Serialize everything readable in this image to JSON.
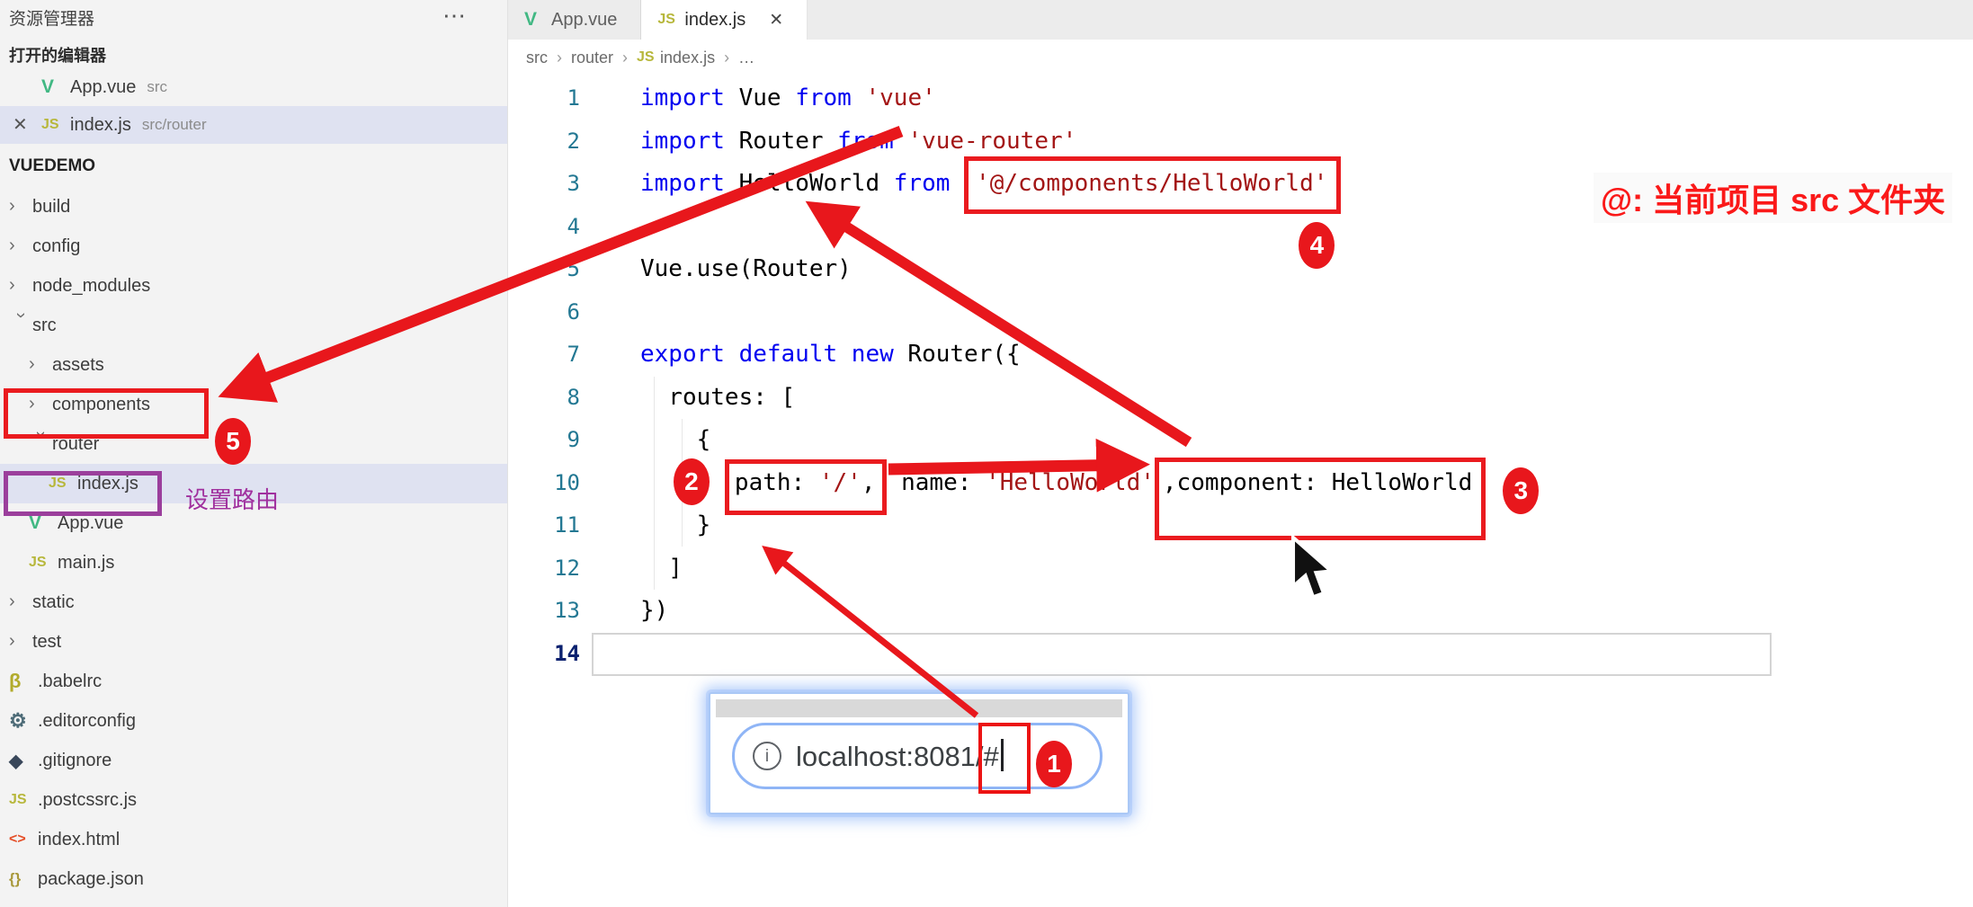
{
  "sidebar": {
    "title": "资源管理器",
    "more_label": "⋯",
    "open_editors": {
      "label": "打开的编辑器",
      "items": [
        {
          "icon": "vue",
          "name": "App.vue",
          "suffix": "src",
          "selected": false,
          "close": ""
        },
        {
          "icon": "js",
          "name": "index.js",
          "suffix": "src/router",
          "selected": true,
          "close": "✕"
        }
      ]
    },
    "project": {
      "label": "VUEDEMO",
      "tree": [
        {
          "level": 1,
          "type": "folder",
          "state": "collapsed",
          "label": "build"
        },
        {
          "level": 1,
          "type": "folder",
          "state": "collapsed",
          "label": "config"
        },
        {
          "level": 1,
          "type": "folder",
          "state": "collapsed",
          "label": "node_modules"
        },
        {
          "level": 1,
          "type": "folder",
          "state": "expanded",
          "label": "src"
        },
        {
          "level": 2,
          "type": "folder",
          "state": "collapsed",
          "label": "assets"
        },
        {
          "level": 2,
          "type": "folder",
          "state": "collapsed",
          "label": "components"
        },
        {
          "level": 2,
          "type": "folder",
          "state": "expanded",
          "label": "router"
        },
        {
          "level": 3,
          "type": "file",
          "icon": "js",
          "label": "index.js",
          "selected": true
        },
        {
          "level": 2,
          "type": "file",
          "icon": "vue",
          "label": "App.vue"
        },
        {
          "level": 2,
          "type": "file",
          "icon": "js",
          "label": "main.js"
        },
        {
          "level": 1,
          "type": "folder",
          "state": "collapsed",
          "label": "static"
        },
        {
          "level": 1,
          "type": "folder",
          "state": "collapsed",
          "label": "test"
        },
        {
          "level": 1,
          "type": "file",
          "icon": "babel",
          "label": ".babelrc"
        },
        {
          "level": 1,
          "type": "file",
          "icon": "gear",
          "label": ".editorconfig"
        },
        {
          "level": 1,
          "type": "file",
          "icon": "git",
          "label": ".gitignore"
        },
        {
          "level": 1,
          "type": "file",
          "icon": "js",
          "label": ".postcssrc.js"
        },
        {
          "level": 1,
          "type": "file",
          "icon": "html",
          "label": "index.html"
        },
        {
          "level": 1,
          "type": "file",
          "icon": "json",
          "label": "package.json"
        }
      ]
    }
  },
  "icons": {
    "vue": {
      "glyph": "V",
      "color": "#41b883",
      "size": "21px"
    },
    "js": {
      "glyph": "JS",
      "color": "#b7b73b",
      "size": "16px"
    },
    "babel": {
      "glyph": "β",
      "color": "#b2ab2c",
      "size": "22px"
    },
    "gear": {
      "glyph": "⚙",
      "color": "#4d6b77",
      "size": "22px"
    },
    "git": {
      "glyph": "◆",
      "color": "#39475a",
      "size": "20px"
    },
    "html": {
      "glyph": "<>",
      "color": "#e44d26",
      "size": "16px"
    },
    "json": {
      "glyph": "{}",
      "color": "#a8983a",
      "size": "17px"
    },
    "chevron": {
      "glyph": "›"
    }
  },
  "tabs": [
    {
      "icon": "vue",
      "label": "App.vue",
      "active": false,
      "close": ""
    },
    {
      "icon": "js",
      "label": "index.js",
      "active": true,
      "close": "✕"
    }
  ],
  "breadcrumb": {
    "separator": "›",
    "items": [
      {
        "label": "src"
      },
      {
        "label": "router"
      },
      {
        "label": "index.js",
        "icon": "js"
      },
      {
        "label": "…"
      }
    ]
  },
  "editor": {
    "lines": [
      {
        "num": "1",
        "segs": [
          {
            "t": "import ",
            "k": "kw"
          },
          {
            "t": "Vue ",
            "k": "p"
          },
          {
            "t": "from ",
            "k": "kw"
          },
          {
            "t": "'vue'",
            "k": "str"
          }
        ]
      },
      {
        "num": "2",
        "segs": [
          {
            "t": "import ",
            "k": "kw"
          },
          {
            "t": "Router ",
            "k": "p"
          },
          {
            "t": "from ",
            "k": "kw"
          },
          {
            "t": "'vue-router'",
            "k": "str"
          }
        ]
      },
      {
        "num": "3",
        "segs": [
          {
            "t": "import ",
            "k": "kw"
          },
          {
            "t": "HelloWorld ",
            "k": "p"
          },
          {
            "t": "from ",
            "k": "kw"
          },
          {
            "t": "'@/components/HelloWorld'",
            "k": "str",
            "box": "b4",
            "circle": "4"
          }
        ]
      },
      {
        "num": "4",
        "segs": []
      },
      {
        "num": "5",
        "segs": [
          {
            "t": "Vue.use(Router)",
            "k": "p"
          }
        ]
      },
      {
        "num": "6",
        "segs": []
      },
      {
        "num": "7",
        "segs": [
          {
            "t": "export default new ",
            "k": "kw"
          },
          {
            "t": "Router({",
            "k": "p"
          }
        ]
      },
      {
        "num": "8",
        "segs": [
          {
            "t": "  routes: [",
            "k": "p"
          }
        ]
      },
      {
        "num": "9",
        "segs": [
          {
            "t": "    {",
            "k": "p"
          }
        ]
      },
      {
        "num": "10",
        "segs": [
          {
            "t": "      ",
            "k": "p"
          },
          {
            "t": "path: ",
            "k": "p",
            "box": "b2",
            "circle": "2"
          },
          {
            "t": "'/'",
            "k": "str",
            "box": "b2"
          },
          {
            "t": ",",
            "k": "p",
            "box": "b2"
          },
          {
            "t": " name: ",
            "k": "p"
          },
          {
            "t": "'HelloWorld'",
            "k": "str"
          },
          {
            "t": ",component: HelloWorld",
            "k": "p",
            "box": "b3",
            "circle": "3"
          }
        ]
      },
      {
        "num": "11",
        "segs": [
          {
            "t": "    }",
            "k": "p"
          }
        ]
      },
      {
        "num": "12",
        "segs": [
          {
            "t": "  ]",
            "k": "p"
          }
        ]
      },
      {
        "num": "13",
        "segs": [
          {
            "t": "})",
            "k": "p"
          }
        ]
      },
      {
        "num": "14",
        "segs": [],
        "active": true
      }
    ]
  },
  "annotations": {
    "circles": {
      "c1": "1",
      "c2": "2",
      "c3": "3",
      "c4": "4",
      "c5": "5"
    },
    "note_right": "@:  当前项目 src 文件夹",
    "purple_note": "设置路由",
    "red": "#e8171c",
    "url_bar": {
      "info_icon": "i",
      "prefix": "localhost:8081/",
      "hash": "#"
    }
  }
}
